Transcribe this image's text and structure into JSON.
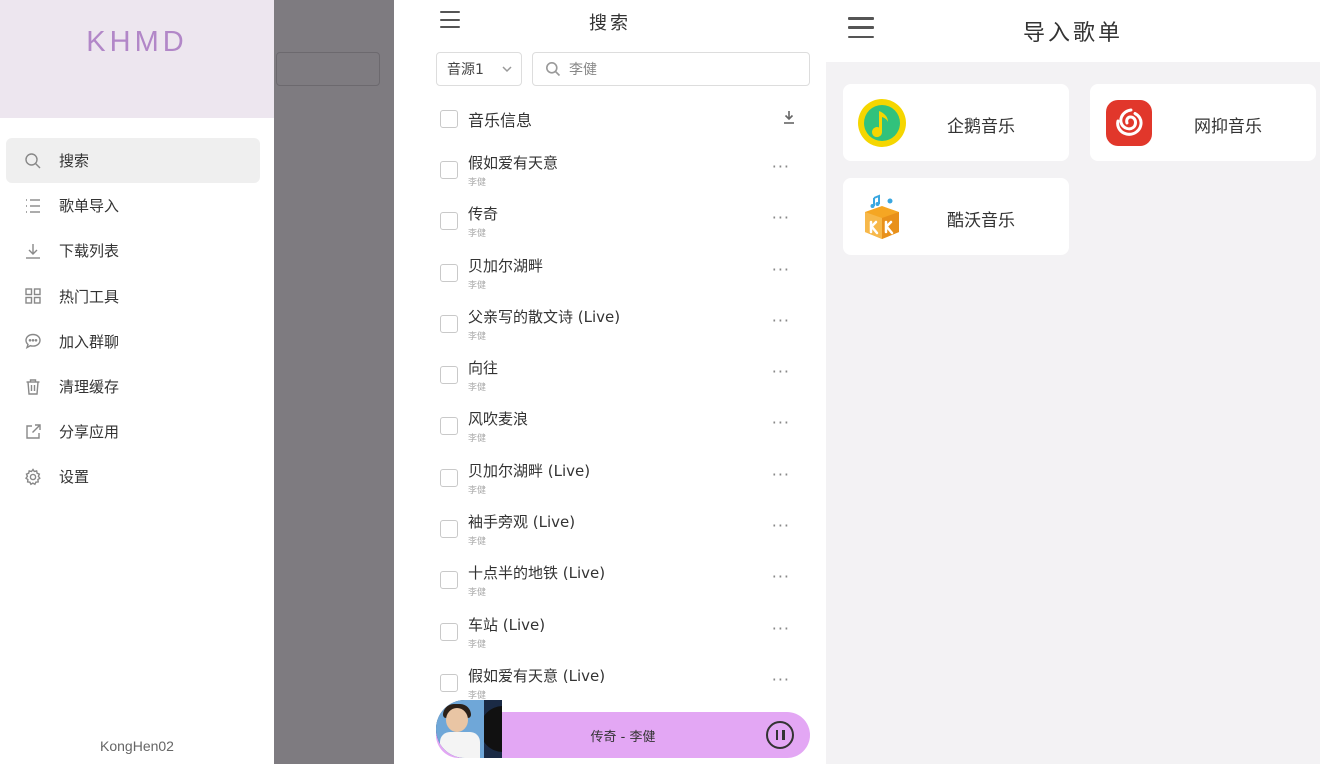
{
  "drawer": {
    "logo": "KHMD",
    "footer": "KongHen02",
    "items": [
      {
        "label": "搜索",
        "icon": "search-icon"
      },
      {
        "label": "歌单导入",
        "icon": "list-icon"
      },
      {
        "label": "下载列表",
        "icon": "download-icon"
      },
      {
        "label": "热门工具",
        "icon": "grid-icon"
      },
      {
        "label": "加入群聊",
        "icon": "chat-icon"
      },
      {
        "label": "清理缓存",
        "icon": "trash-icon"
      },
      {
        "label": "分享应用",
        "icon": "share-icon"
      },
      {
        "label": "设置",
        "icon": "gear-icon"
      }
    ]
  },
  "search_page": {
    "title": "搜索",
    "source_select": "音源1",
    "search_value": "李健",
    "list_header": "音乐信息",
    "songs": [
      {
        "title": "假如爱有天意",
        "artist": "李健"
      },
      {
        "title": "传奇",
        "artist": "李健"
      },
      {
        "title": "贝加尔湖畔",
        "artist": "李健"
      },
      {
        "title": "父亲写的散文诗 (Live)",
        "artist": "李健"
      },
      {
        "title": "向往",
        "artist": "李健"
      },
      {
        "title": "风吹麦浪",
        "artist": "李健"
      },
      {
        "title": "贝加尔湖畔 (Live)",
        "artist": "李健"
      },
      {
        "title": "袖手旁观 (Live)",
        "artist": "李健"
      },
      {
        "title": "十点半的地铁 (Live)",
        "artist": "李健"
      },
      {
        "title": "车站 (Live)",
        "artist": "李健"
      },
      {
        "title": "假如爱有天意 (Live)",
        "artist": "李健"
      }
    ],
    "more_label": "···",
    "player": {
      "now_playing": "传奇 - 李健"
    }
  },
  "import_page": {
    "title": "导入歌单",
    "sources": [
      {
        "label": "企鹅音乐",
        "icon": "qq-music-icon",
        "color": "#f5d600"
      },
      {
        "label": "网抑音乐",
        "icon": "netease-music-icon",
        "color": "#e1372b"
      },
      {
        "label": "酷沃音乐",
        "icon": "kuwo-music-icon",
        "color": "#f5a623"
      }
    ]
  },
  "colors": {
    "logo": "#b287c8",
    "drawer_header": "#ede6ef",
    "player_bg": "#e3a7f4",
    "overlay": "#7e7b80",
    "import_bg": "#f3f2f4"
  }
}
